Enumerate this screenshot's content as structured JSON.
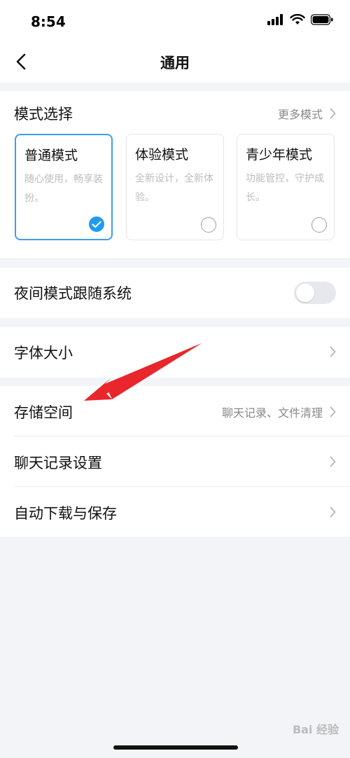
{
  "status_bar": {
    "time": "8:54"
  },
  "header": {
    "title": "通用"
  },
  "mode_section": {
    "label": "模式选择",
    "more_label": "更多模式",
    "cards": [
      {
        "title": "普通模式",
        "description": "随心使用，畅享装扮。",
        "selected": true
      },
      {
        "title": "体验模式",
        "description": "全新设计，全新体验。",
        "selected": false
      },
      {
        "title": "青少年模式",
        "description": "功能管控，守护成长。",
        "selected": false
      }
    ]
  },
  "night_mode": {
    "label": "夜间模式跟随系统",
    "enabled": false
  },
  "font_size": {
    "label": "字体大小"
  },
  "storage_section": {
    "items": [
      {
        "label": "存储空间",
        "detail": "聊天记录、文件清理"
      },
      {
        "label": "聊天记录设置",
        "detail": ""
      },
      {
        "label": "自动下载与保存",
        "detail": ""
      }
    ]
  },
  "colors": {
    "accent": "#1e9bf0",
    "annotation_arrow": "#e8262b",
    "background": "#f3f4f8"
  },
  "watermark": "Bai 经验"
}
